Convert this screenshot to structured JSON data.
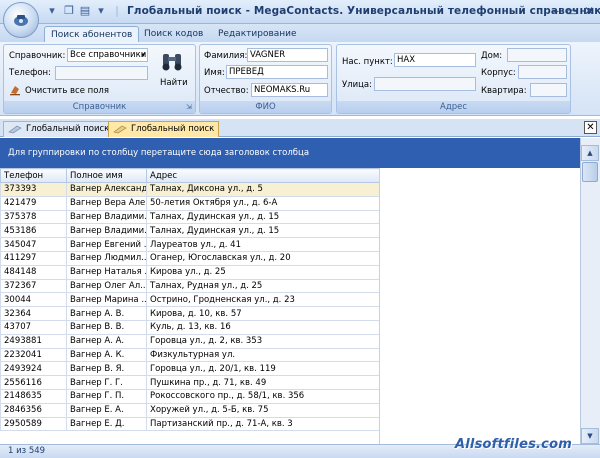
{
  "window": {
    "title": "Глобальный поиск - MegaContacts. Универсальный телефонный справочник",
    "minimize": "–",
    "restore": "▭",
    "close": "✕"
  },
  "ribbon_tabs": [
    "Поиск абонентов",
    "Поиск кодов",
    "Редактирование"
  ],
  "ribbon": {
    "spravochnik": {
      "caption": "Справочник",
      "label_sprav": "Справочник:",
      "sprav_value": "Все справочники",
      "label_phone": "Телефон:",
      "phone_value": "",
      "clear_label": "Очистить все поля",
      "find_label": "Найти"
    },
    "fio": {
      "caption": "ФИО",
      "label_surname": "Фамилия:",
      "surname_value": "VAGNER",
      "label_name": "Имя:",
      "name_value": "ПРЕВЕД",
      "label_patronymic": "Отчество:",
      "patronymic_value": "NEOMAKS.Ru"
    },
    "address": {
      "caption": "Адрес",
      "label_city": "Нас. пункт:",
      "city_value": "HAX",
      "label_street": "Улица:",
      "street_value": "",
      "label_house": "Дом:",
      "house_value": "",
      "label_building": "Корпус:",
      "building_value": "",
      "label_apartment": "Квартира:",
      "apartment_value": ""
    }
  },
  "doc_tabs": [
    "Глобальный поиск",
    "Глобальный поиск"
  ],
  "doc_close": "✕",
  "group_panel_text": "Для группировки по столбцу перетащите сюда заголовок столбца",
  "grid": {
    "columns": [
      "Телефон",
      "Полное имя",
      "Адрес"
    ],
    "rows": [
      [
        "373393",
        "Вагнер Александ...",
        "Талнах, Диксона ул., д. 5"
      ],
      [
        "421479",
        "Вагнер Вера Але...",
        "50-летия Октября ул., д. 6-А"
      ],
      [
        "375378",
        "Вагнер Владими...",
        "Талнах, Дудинская ул., д. 15"
      ],
      [
        "453186",
        "Вагнер Владими...",
        "Талнах, Дудинская ул., д. 15"
      ],
      [
        "345047",
        "Вагнер Евгений ...",
        "Лауреатов ул., д. 41"
      ],
      [
        "411297",
        "Вагнер Людмил...",
        "Оганер, Югославская ул., д. 20"
      ],
      [
        "484148",
        "Вагнер Наталья ...",
        "Кирова ул., д. 25"
      ],
      [
        "372367",
        "Вагнер Олег Ал...",
        "Талнах, Рудная ул., д. 25"
      ],
      [
        "30044",
        "Вагнер Марина ...",
        "Острино, Гродненская ул., д. 23"
      ],
      [
        "32364",
        "Вагнер А. В.",
        "Кирова, д. 10, кв. 57"
      ],
      [
        "43707",
        "Вагнер В. В.",
        "Куль, д. 13, кв. 16"
      ],
      [
        "2493881",
        "Вагнер А. А.",
        "Горовца ул., д. 2, кв. 353"
      ],
      [
        "2232041",
        "Вагнер А. К.",
        "Физкультурная ул."
      ],
      [
        "2493924",
        "Вагнер В. Я.",
        "Горовца ул., д. 20/1, кв. 119"
      ],
      [
        "2556116",
        "Вагнер Г. Г.",
        "Пушкина пр., д. 71, кв. 49"
      ],
      [
        "2148635",
        "Вагнер Г. П.",
        "Рокоссовского пр., д. 58/1, кв. 356"
      ],
      [
        "2846356",
        "Вагнер Е. А.",
        "Хоружей ул., д. 5-Б, кв. 75"
      ],
      [
        "2950589",
        "Вагнер Е. Д.",
        "Партизанский пр., д. 71-А, кв. 3"
      ]
    ]
  },
  "scroll": {
    "up": "▲",
    "down": "▼"
  },
  "status_text": "1 из 549",
  "watermark": "Allsoftfiles.com",
  "colors": {
    "accent": "#2f5fb1",
    "selected_row": "#f7f0d2",
    "active_tab": "#ffe8a8"
  }
}
